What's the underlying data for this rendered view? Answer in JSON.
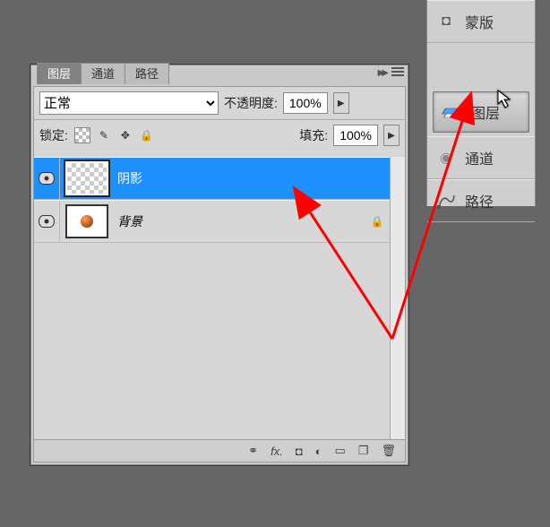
{
  "panel": {
    "tabs": [
      {
        "label": "图层",
        "active": true
      },
      {
        "label": "通道",
        "active": false
      },
      {
        "label": "路径",
        "active": false
      }
    ],
    "blend_mode": "正常",
    "opacity_label": "不透明度:",
    "opacity_value": "100%",
    "lock_label": "锁定:",
    "fill_label": "填充:",
    "fill_value": "100%"
  },
  "layers": [
    {
      "name": "阴影",
      "visible": true,
      "selected": true,
      "transparent_thumb": true,
      "locked": false
    },
    {
      "name": "背景",
      "visible": true,
      "selected": false,
      "transparent_thumb": false,
      "locked": true
    }
  ],
  "footer_icons": [
    "link-icon",
    "fx-icon",
    "mask-icon",
    "adjustment-icon",
    "group-icon",
    "new-layer-icon",
    "trash-icon"
  ],
  "sidebar": {
    "items": [
      {
        "label": "蒙版",
        "icon": "mask-icon",
        "pressed": false
      },
      {
        "label": "图层",
        "icon": "layers-icon",
        "pressed": true
      },
      {
        "label": "通道",
        "icon": "channels-icon",
        "pressed": false
      },
      {
        "label": "路径",
        "icon": "paths-icon",
        "pressed": false
      }
    ]
  },
  "icon_glyphs": {
    "link": "⚭",
    "fx": "fx.",
    "mask": "◐",
    "adjust": "◑",
    "group": "▭",
    "new": "❐",
    "trash": "🗑",
    "brush": "✎",
    "move": "✥",
    "lock": "🔒",
    "play": "▶",
    "channels": "⬤"
  },
  "colors": {
    "selection": "#1e90ff",
    "panel_bg": "#d7d7d7",
    "arrow": "#ff0000"
  }
}
